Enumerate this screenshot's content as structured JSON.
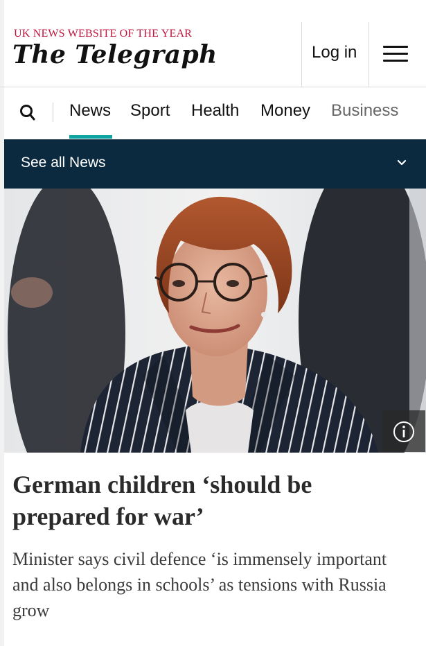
{
  "header": {
    "tagline": "UK NEWS WEBSITE OF THE YEAR",
    "masthead": "The Telegraph",
    "login_label": "Log in",
    "menu_icon": "hamburger-menu-icon"
  },
  "nav": {
    "search_icon": "search-icon",
    "items": [
      "News",
      "Sport",
      "Health",
      "Money",
      "Business"
    ],
    "active": "News",
    "accent_color": "#0fa3a3"
  },
  "see_all": {
    "label": "See all News",
    "icon": "chevron-down-icon",
    "background": "#0c2a3f"
  },
  "hero": {
    "info_icon": "info-icon"
  },
  "article": {
    "headline": "German children ‘should be prepared for war’",
    "standfirst": "Minister says civil defence ‘is immensely important and also belongs in schools’ as tensions with Russia grow"
  },
  "colors": {
    "brand_red": "#c0143c"
  }
}
